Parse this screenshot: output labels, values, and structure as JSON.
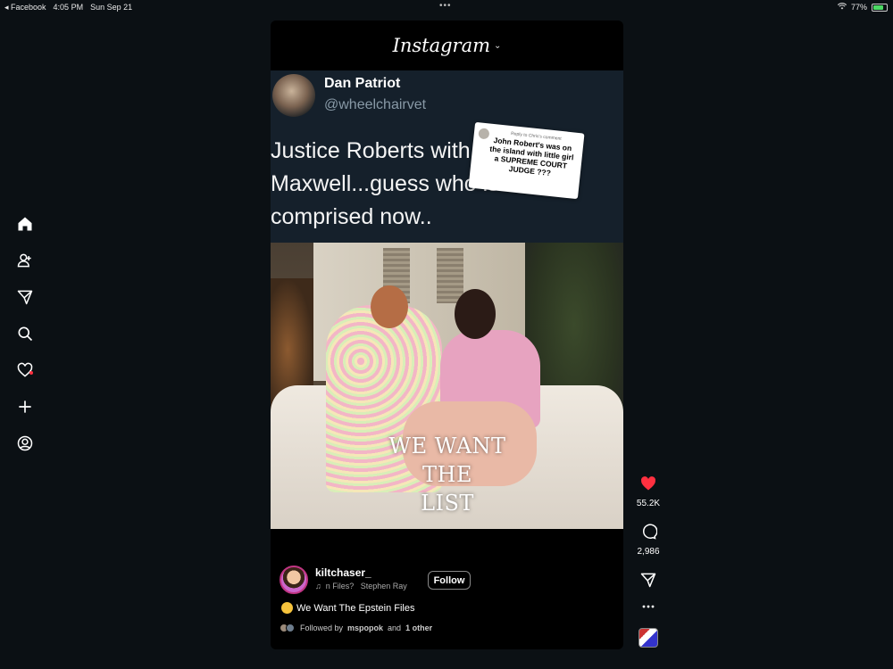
{
  "status_bar": {
    "back_app": "◂ Facebook",
    "time": "4:05 PM",
    "date": "Sun Sep 21",
    "multitask_dots": "•••",
    "battery": "77%",
    "battery_level": 0.77
  },
  "header": {
    "logo": "Instagram",
    "chevron": "⌄"
  },
  "tweet": {
    "name": "Dan Patriot",
    "handle": "@wheelchairvet",
    "text_lines": [
      "Justice Roberts with",
      "Maxwell...guess who is",
      "comprised now.."
    ]
  },
  "reply_sticker": {
    "label": "Reply to Chris's comment",
    "text": "John Robert's was on the island with little girl a SUPREME COURT JUDGE ???"
  },
  "photo_overlay": {
    "lines": [
      "WE WANT",
      "THE",
      "LIST"
    ]
  },
  "author": {
    "username": "kiltchaser_",
    "music": "♫  n Files?   Stephen Ray",
    "follow_label": "Follow"
  },
  "caption": "We Want The Epstein Files",
  "followed_by": {
    "prefix": "Followed by",
    "user": "mspopok",
    "middle": "and",
    "others": "1 other"
  },
  "actions": {
    "likes": "55.2K",
    "comments": "2,986"
  },
  "colors": {
    "like": "#ff3040",
    "background": "#0b1014",
    "tweet_bg": "#15202b"
  },
  "icons": [
    "home-icon",
    "friends-icon",
    "send-icon",
    "search-icon",
    "heart-icon",
    "plus-icon",
    "profile-icon",
    "comment-icon",
    "more-icon"
  ]
}
